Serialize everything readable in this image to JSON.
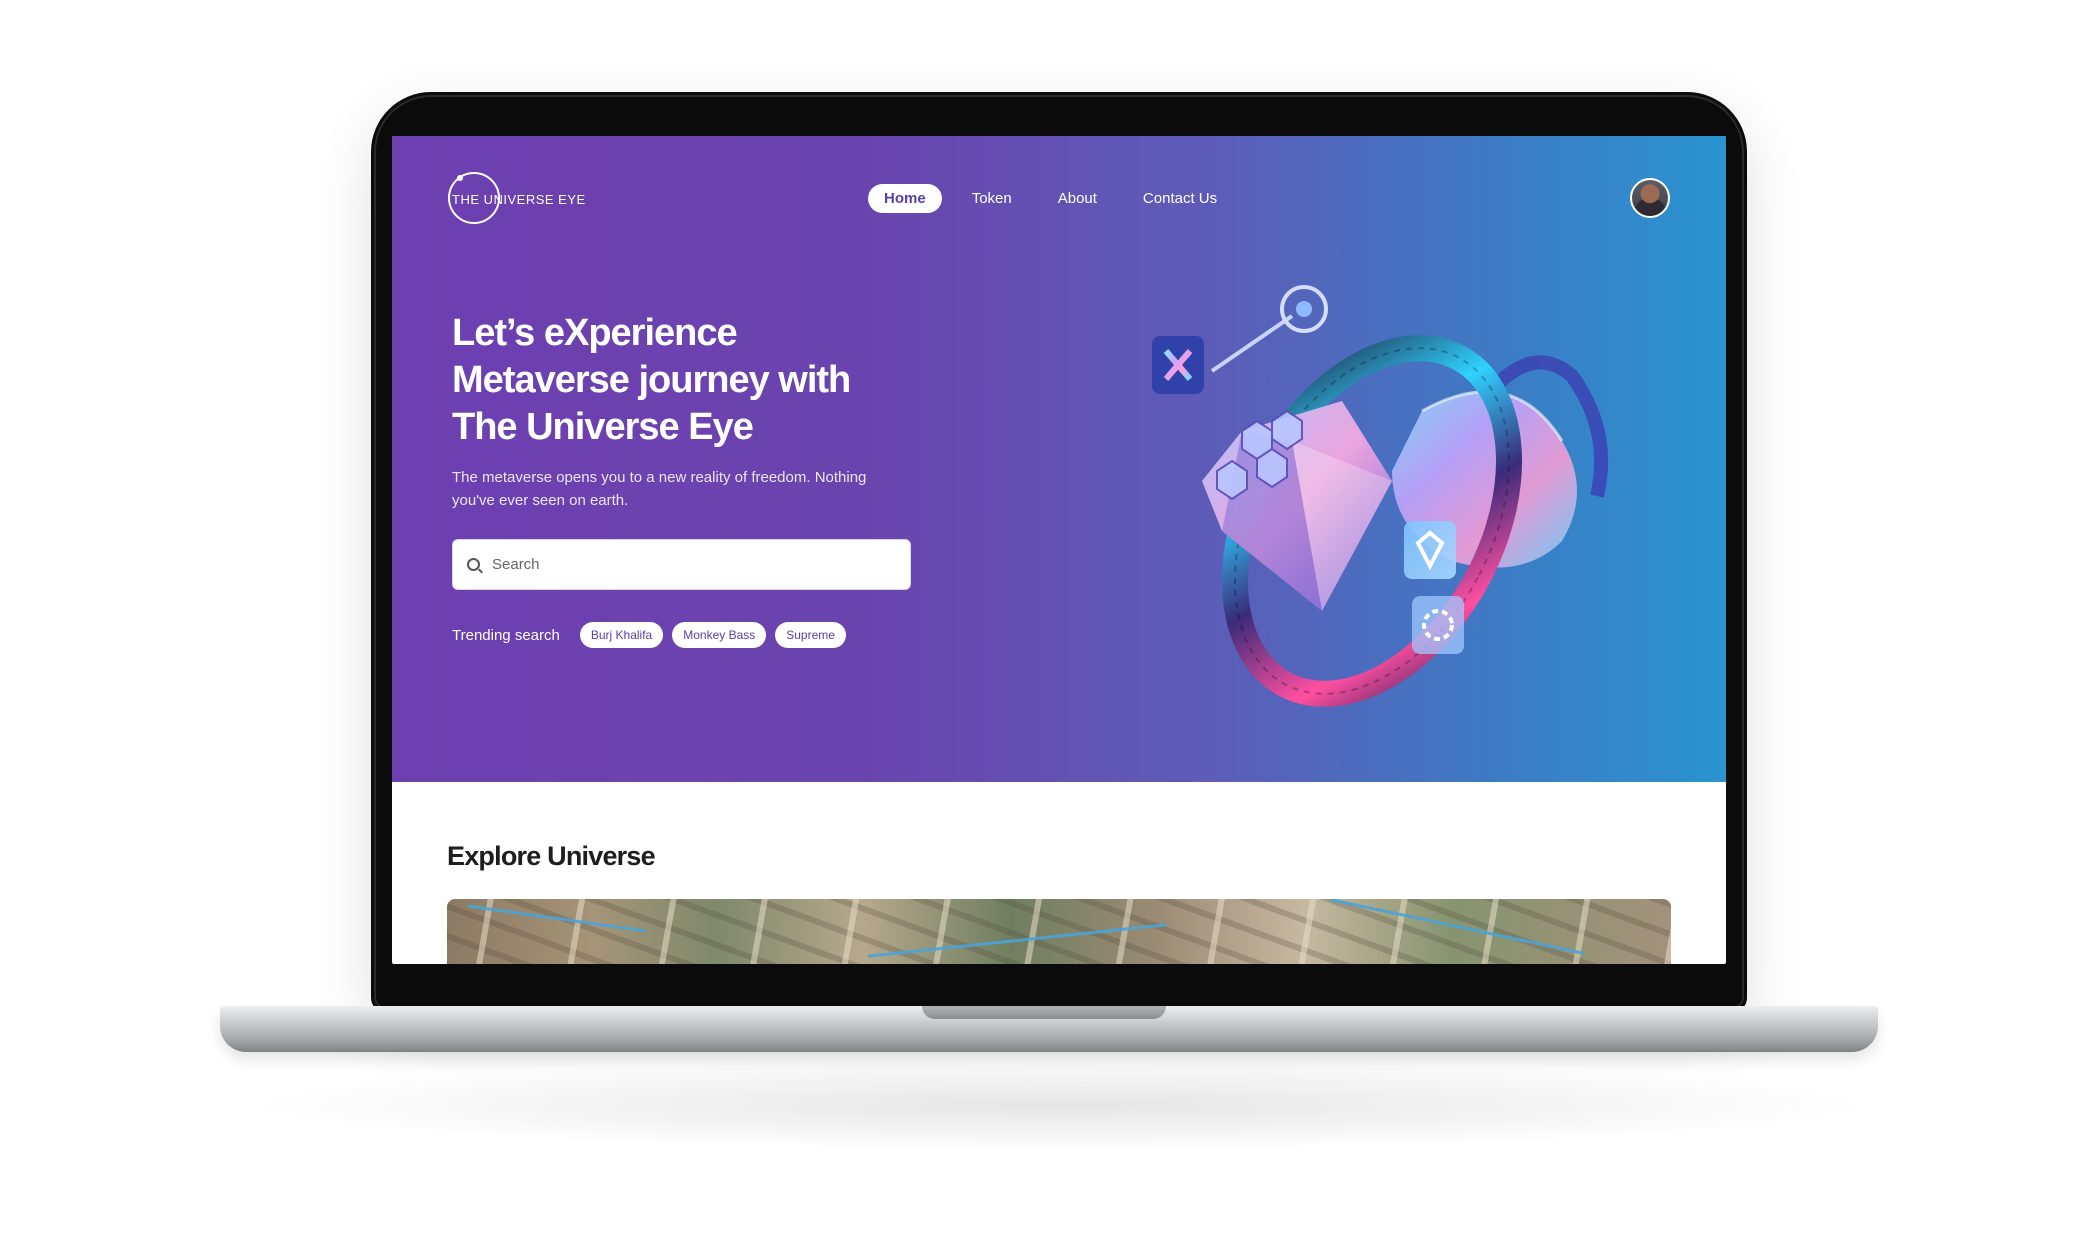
{
  "site": {
    "logo_text": "THE UNIVERSE EYE"
  },
  "nav": {
    "items": [
      {
        "label": "Home",
        "active": true
      },
      {
        "label": "Token",
        "active": false
      },
      {
        "label": "About",
        "active": false
      },
      {
        "label": "Contact Us",
        "active": false
      }
    ]
  },
  "hero": {
    "headline_line1": "Let’s eXperience",
    "headline_line2": "Metaverse journey with",
    "headline_line3": "The Universe Eye",
    "subtext": "The metaverse opens you to a new reality of freedom. Nothing you've ever seen on earth.",
    "search_placeholder": "Search",
    "trending_label": "Trending search",
    "trending_chips": [
      "Burj Khalifa",
      "Monkey Bass",
      "Supreme"
    ]
  },
  "explore": {
    "title": "Explore Universe"
  },
  "colors": {
    "hero_start": "#6d3fb0",
    "hero_end": "#2a94d0",
    "accent": "#5a3fa5"
  },
  "icons": [
    "search-icon",
    "user-avatar",
    "logo-ring"
  ]
}
